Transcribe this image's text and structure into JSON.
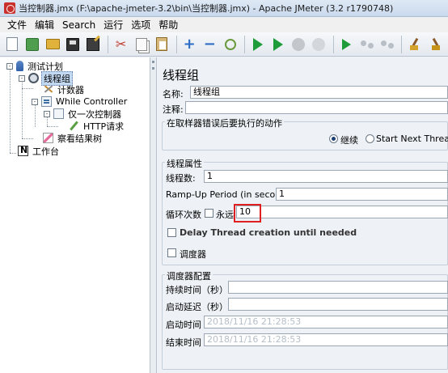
{
  "window": {
    "title": "当控制器.jmx (F:\\apache-jmeter-3.2\\bin\\当控制器.jmx) - Apache JMeter (3.2 r1790748)"
  },
  "menu": [
    "文件",
    "编辑",
    "Search",
    "运行",
    "选项",
    "帮助"
  ],
  "toolbar": {
    "icons": [
      "new-icon",
      "templates-icon",
      "open-icon",
      "save-icon",
      "save-as-icon",
      "cut-icon",
      "copy-icon",
      "paste-icon",
      "expand-icon",
      "collapse-icon",
      "toggle-icon",
      "start-icon",
      "start-no-pause-icon",
      "stop-icon",
      "shutdown-icon",
      "remote-start-all-icon",
      "remote-stop-icon",
      "remote-shutdown-icon",
      "clear-icon",
      "clear-all-icon"
    ]
  },
  "tree": {
    "test_plan": "测试计划",
    "thread_group": "线程组",
    "counter": "计数器",
    "while_controller": "While Controller",
    "once_only_controller": "仅一次控制器",
    "http_request": "HTTP请求",
    "result_tree": "察看结果树",
    "workbench": "工作台"
  },
  "panel": {
    "title": "线程组",
    "name_label": "名称:",
    "name_value": "线程组",
    "comment_label": "注释:",
    "comment_value": "",
    "error_group_title": "在取样器错误后要执行的动作",
    "continue_label": "继续",
    "start_next_label": "Start Next Thread Lo",
    "thread_props_title": "线程属性",
    "threads_label": "线程数:",
    "threads_value": "1",
    "rampup_label": "Ramp-Up Period (in seconds):",
    "rampup_value": "1",
    "loop_label": "循环次数",
    "forever_label": "永远",
    "loop_value": "10",
    "delay_label": "Delay Thread creation until needed",
    "scheduler_label": "调度器",
    "scheduler_config_title": "调度器配置",
    "duration_label": "持续时间（秒）",
    "duration_value": "",
    "startup_delay_label": "启动延迟（秒）",
    "startup_delay_value": "",
    "start_time_label": "启动时间",
    "start_time_value": "2018/11/16 21:28:53",
    "end_time_label": "结束时间",
    "end_time_value": "2018/11/16 21:28:53"
  },
  "colors": {
    "highlight_border": "#e02020"
  }
}
